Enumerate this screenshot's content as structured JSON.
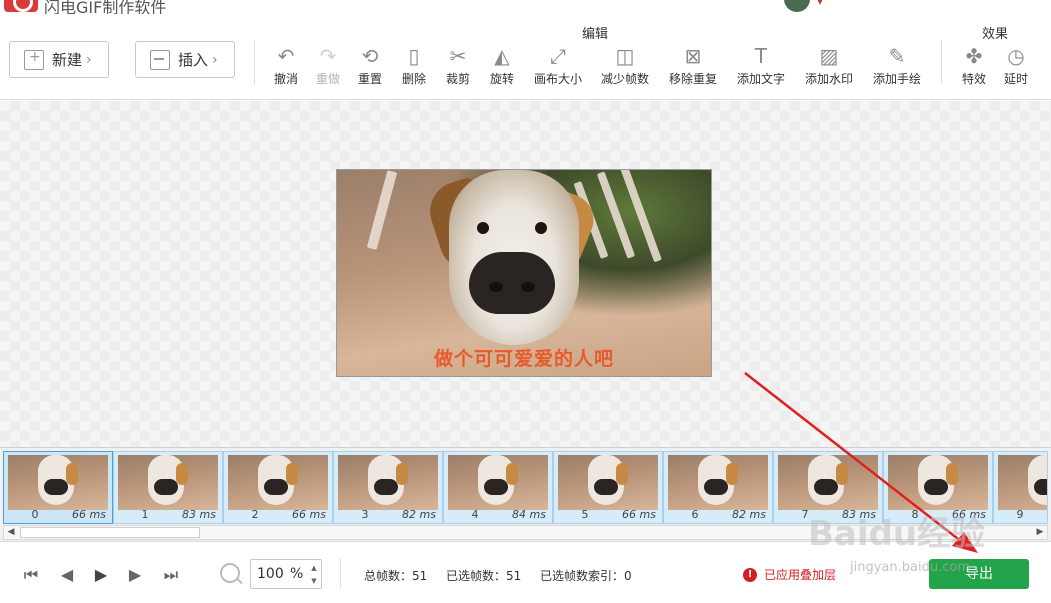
{
  "titlebar": {
    "app_title": "闪电GIF制作软件"
  },
  "toolbar": {
    "new_label": "新建",
    "insert_label": "插入",
    "edit_group": "编辑",
    "effects_group": "效果",
    "tools": [
      {
        "label": "撤消",
        "icon": "undo-icon",
        "disabled": false
      },
      {
        "label": "重做",
        "icon": "redo-icon",
        "disabled": true
      },
      {
        "label": "重置",
        "icon": "reset-icon",
        "disabled": false
      },
      {
        "label": "删除",
        "icon": "trash-icon",
        "disabled": false
      },
      {
        "label": "裁剪",
        "icon": "scissors-icon",
        "disabled": false
      },
      {
        "label": "旋转",
        "icon": "rotate-icon",
        "disabled": false
      },
      {
        "label": "画布大小",
        "icon": "canvas-size-icon",
        "disabled": false
      },
      {
        "label": "减少帧数",
        "icon": "reduce-frames-icon",
        "disabled": false
      },
      {
        "label": "移除重复",
        "icon": "remove-duplicates-icon",
        "disabled": false
      },
      {
        "label": "添加文字",
        "icon": "text-icon",
        "disabled": false
      },
      {
        "label": "添加水印",
        "icon": "watermark-icon",
        "disabled": false
      },
      {
        "label": "添加手绘",
        "icon": "pen-icon",
        "disabled": false
      }
    ],
    "effects": [
      {
        "label": "特效",
        "icon": "effects-icon"
      },
      {
        "label": "延时",
        "icon": "timer-icon"
      }
    ]
  },
  "preview": {
    "caption": "做个可可爱爱的人吧"
  },
  "frames": [
    {
      "index": "0",
      "ms": "66 ms"
    },
    {
      "index": "1",
      "ms": "83 ms"
    },
    {
      "index": "2",
      "ms": "66 ms"
    },
    {
      "index": "3",
      "ms": "82 ms"
    },
    {
      "index": "4",
      "ms": "84 ms"
    },
    {
      "index": "5",
      "ms": "66 ms"
    },
    {
      "index": "6",
      "ms": "82 ms"
    },
    {
      "index": "7",
      "ms": "83 ms"
    },
    {
      "index": "8",
      "ms": "66 ms"
    },
    {
      "index": "9",
      "ms": ""
    }
  ],
  "status": {
    "zoom_value": "100",
    "zoom_unit": "%",
    "total_frames": "总帧数：51",
    "selected_frames": "已选帧数：51",
    "selected_index": "已选帧数索引：0",
    "warning": "已应用叠加层",
    "export_label": "导出"
  },
  "watermark": {
    "brand": "Baidu经验",
    "url": "jingyan.baidu.com"
  },
  "colors": {
    "accent_green": "#23a34a",
    "warning_red": "#d42020",
    "caption_orange": "#e85a2a",
    "arrow_red": "#e02020"
  }
}
